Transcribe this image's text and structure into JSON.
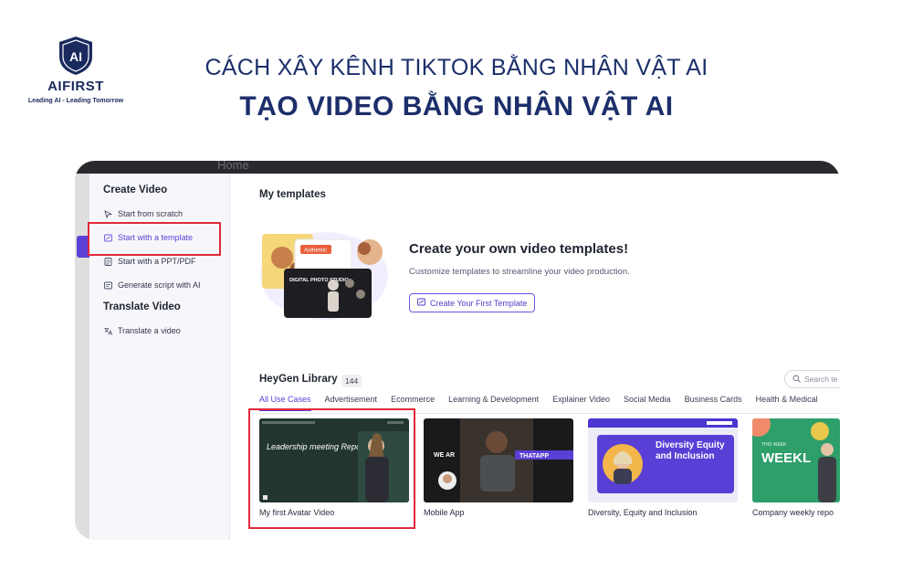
{
  "banner": {
    "logo_name": "AIFIRST",
    "logo_mark": "AI",
    "logo_tagline": "Leading AI - Leading Tomorrow",
    "heading_line1": "CÁCH XÂY KÊNH TIKTOK BẰNG NHÂN VẬT AI",
    "heading_line2": "TẠO VIDEO BẰNG NHÂN VẬT AI",
    "color_navy": "#1c2f6b"
  },
  "screenshot": {
    "ghost_header": "Home",
    "sidebar": {
      "create_video_title": "Create Video",
      "items": [
        {
          "label": "Start from scratch",
          "icon": "cursor-icon"
        },
        {
          "label": "Start with a template",
          "icon": "template-icon"
        },
        {
          "label": "Start with a PPT/PDF",
          "icon": "document-icon"
        },
        {
          "label": "Generate script with AI",
          "icon": "script-icon"
        }
      ],
      "translate_title": "Translate Video",
      "translate_items": [
        {
          "label": "Translate a video",
          "icon": "translate-icon"
        }
      ]
    },
    "main": {
      "my_templates_title": "My templates",
      "promo": {
        "title": "Create your own video templates!",
        "subtitle": "Customize templates to streamline your video production.",
        "button": "Create Your First Template",
        "visual_texts": [
          "Authentic",
          "DIGITAL PHOTO STUDIO"
        ]
      },
      "library": {
        "title": "HeyGen Library",
        "count": "144",
        "search_placeholder": "Search te",
        "tabs": [
          "All Use Cases",
          "Advertisement",
          "Ecommerce",
          "Learning & Development",
          "Explainer Video",
          "Social Media",
          "Business Cards",
          "Health & Medical"
        ],
        "active_tab": "All Use Cases",
        "cards": [
          {
            "label": "My first Avatar Video",
            "thumb_text": "Leadership meeting Report"
          },
          {
            "label": "Mobile App",
            "thumb_text": "THATAPP",
            "thumb_text2": "WE AR"
          },
          {
            "label": "Diversity, Equity and Inclusion",
            "thumb_text": "Diversity Equity and Inclusion"
          },
          {
            "label": "Company weekly repo",
            "thumb_text": "WEEKL",
            "thumb_text2": "THIS WEEK"
          }
        ]
      }
    },
    "colors": {
      "accent": "#5b3fd6",
      "highlight": "#e0283a"
    }
  }
}
